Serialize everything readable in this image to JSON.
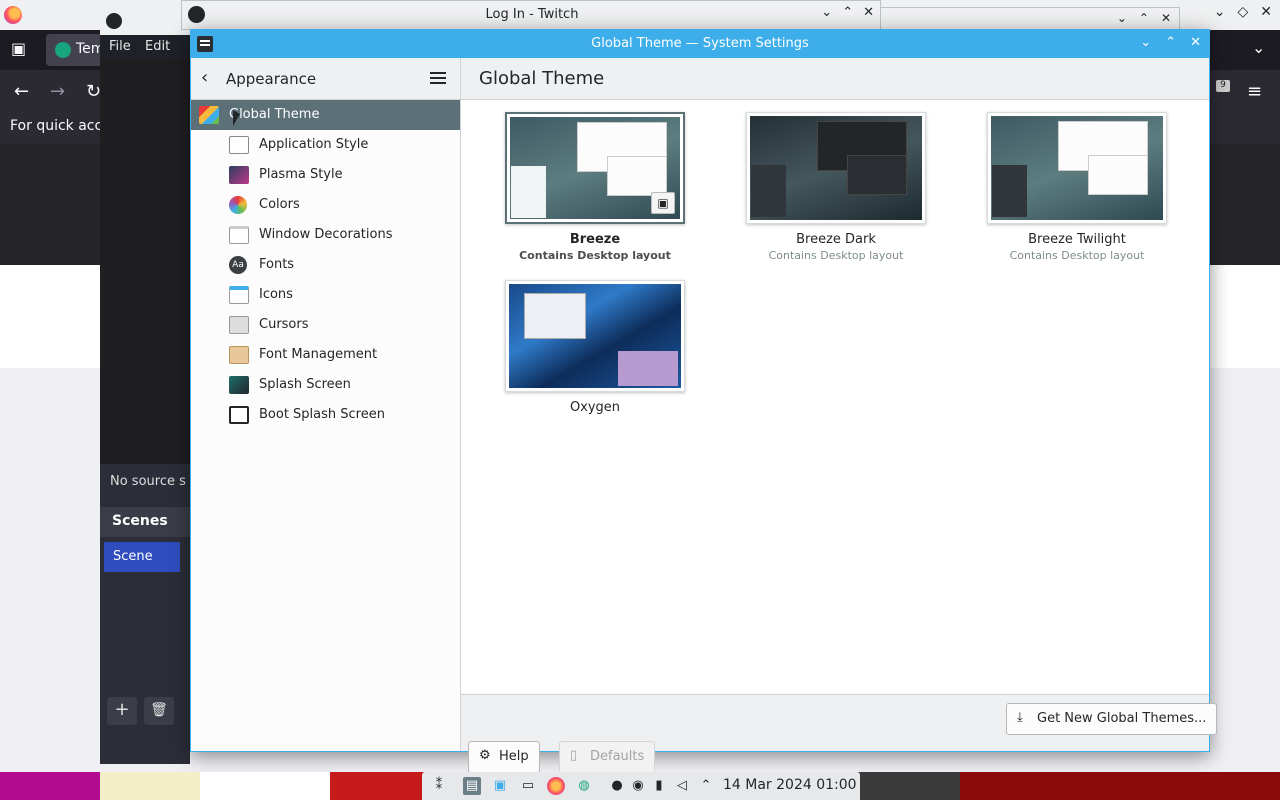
{
  "firefox": {
    "tab_label": "Tem",
    "infobar_text": "For quick acc",
    "badge_count": "9"
  },
  "obs": {
    "menu": [
      "File",
      "Edit"
    ],
    "no_source_text": "No source s",
    "scenes_header": "Scenes",
    "scene_item": "Scene",
    "add_label": "+",
    "remove_label": "🗑"
  },
  "twitch_window": {
    "title": "Log In - Twitch"
  },
  "settings": {
    "window_title": "Global Theme — System Settings",
    "sidebar": {
      "back_label": "Appearance",
      "items": [
        {
          "label": "Global Theme",
          "icon": "global-theme-icon",
          "active": true
        },
        {
          "label": "Application Style",
          "icon": "application-style-icon"
        },
        {
          "label": "Plasma Style",
          "icon": "plasma-style-icon"
        },
        {
          "label": "Colors",
          "icon": "colors-icon"
        },
        {
          "label": "Window Decorations",
          "icon": "window-decorations-icon"
        },
        {
          "label": "Fonts",
          "icon": "fonts-icon"
        },
        {
          "label": "Icons",
          "icon": "icons-icon"
        },
        {
          "label": "Cursors",
          "icon": "cursors-icon"
        },
        {
          "label": "Font Management",
          "icon": "font-management-icon"
        },
        {
          "label": "Splash Screen",
          "icon": "splash-screen-icon"
        },
        {
          "label": "Boot Splash Screen",
          "icon": "boot-splash-icon"
        }
      ]
    },
    "page_title": "Global Theme",
    "themes": [
      {
        "name": "Breeze",
        "desc": "Contains Desktop layout",
        "selected": true
      },
      {
        "name": "Breeze Dark",
        "desc": "Contains Desktop layout"
      },
      {
        "name": "Breeze Twilight",
        "desc": "Contains Desktop layout"
      },
      {
        "name": "Oxygen",
        "desc": ""
      }
    ],
    "buttons": {
      "get_new": "Get New Global Themes...",
      "help": "Help",
      "defaults": "Defaults"
    },
    "colors": {
      "accent": "#3daee9",
      "sidebar_selected": "#5c7077"
    }
  },
  "taskbar": {
    "clock": "14 Mar 2024  01:00"
  }
}
